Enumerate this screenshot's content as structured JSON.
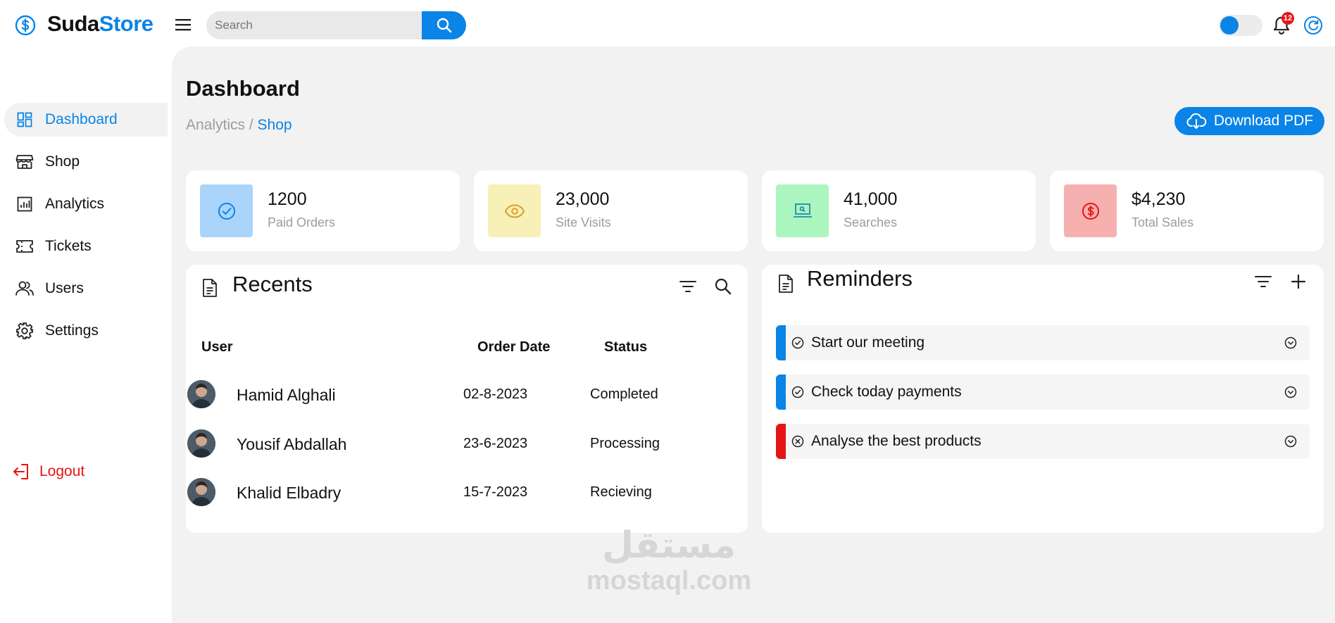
{
  "app": {
    "name_part1": "Suda",
    "name_part2": "Store",
    "accent": "#0a84e6",
    "danger": "#e51515"
  },
  "header": {
    "search_placeholder": "Search",
    "notification_count": "12",
    "theme_toggle_on": true
  },
  "sidebar": {
    "items": [
      {
        "label": "Dashboard",
        "icon": "dashboard-grid-icon",
        "active": true
      },
      {
        "label": "Shop",
        "icon": "storefront-icon"
      },
      {
        "label": "Analytics",
        "icon": "bar-chart-icon"
      },
      {
        "label": "Tickets",
        "icon": "ticket-icon"
      },
      {
        "label": "Users",
        "icon": "users-icon"
      },
      {
        "label": "Settings",
        "icon": "gear-icon"
      }
    ],
    "logout_label": "Logout"
  },
  "page": {
    "title": "Dashboard",
    "breadcrumb": {
      "parent": "Analytics",
      "separator": " / ",
      "current": "Shop"
    },
    "download_label": "Download PDF"
  },
  "stats": [
    {
      "value": "1200",
      "label": "Paid Orders",
      "icon": "check-circle-icon",
      "color": "#abd4fb"
    },
    {
      "value": "23,000",
      "label": "Site Visits",
      "icon": "eye-icon",
      "color": "#f7f0b7"
    },
    {
      "value": "41,000",
      "label": "Searches",
      "icon": "laptop-icon",
      "color": "#abf6be"
    },
    {
      "value": "$4,230",
      "label": "Total Sales",
      "icon": "dollar-circle-icon",
      "color": "#f6b0b0"
    }
  ],
  "recents": {
    "title": "Recents",
    "columns": [
      "User",
      "Order Date",
      "Status"
    ],
    "rows": [
      {
        "user": "Hamid Alghali",
        "date": "02-8-2023",
        "status": "Completed"
      },
      {
        "user": "Yousif Abdallah",
        "date": "23-6-2023",
        "status": "Processing"
      },
      {
        "user": "Khalid Elbadry",
        "date": "15-7-2023",
        "status": "Recieving"
      }
    ]
  },
  "reminders": {
    "title": "Reminders",
    "items": [
      {
        "text": "Start our meeting",
        "state": "done",
        "color": "#0a84e6"
      },
      {
        "text": "Check today payments",
        "state": "done",
        "color": "#0a84e6"
      },
      {
        "text": "Analyse the best products",
        "state": "cancelled",
        "color": "#e51515"
      }
    ]
  },
  "watermark": {
    "arabic": "مستقل",
    "latin": "mostaql.com"
  }
}
